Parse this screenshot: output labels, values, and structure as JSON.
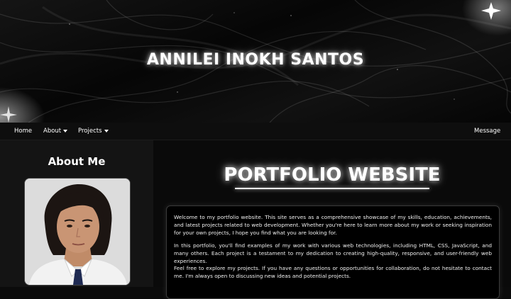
{
  "hero": {
    "title": "ANNILEI INOKH SANTOS"
  },
  "nav": {
    "home": "Home",
    "about": "About",
    "projects": "Projects",
    "message": "Message"
  },
  "sidebar": {
    "heading": "About Me"
  },
  "main": {
    "title": "PORTFOLIO WEBSITE",
    "paragraphs": [
      "Welcome to my portfolio website. This site serves as a comprehensive showcase of my skills, education, achievements, and latest projects related to web development. Whether you're here to learn more about my work or seeking inspiration for your own projects, I hope you find what you are looking for.",
      "In this portfolio, you'll find examples of my work with various web technologies, including HTML, CSS, JavaScript, and many others. Each project is a testament to my dedication to creating high-quality, responsive, and user-friendly web experiences.",
      "Feel free to explore my projects. If you have any questions or opportunities for collaboration, do not hesitate to contact me. I'm always open to discussing new ideas and potential projects."
    ]
  },
  "colors": {
    "background": "#0b0b0b",
    "navbar": "#0e0e0e",
    "sidebar": "#141414",
    "card": "#000000",
    "text": "#ffffff"
  }
}
